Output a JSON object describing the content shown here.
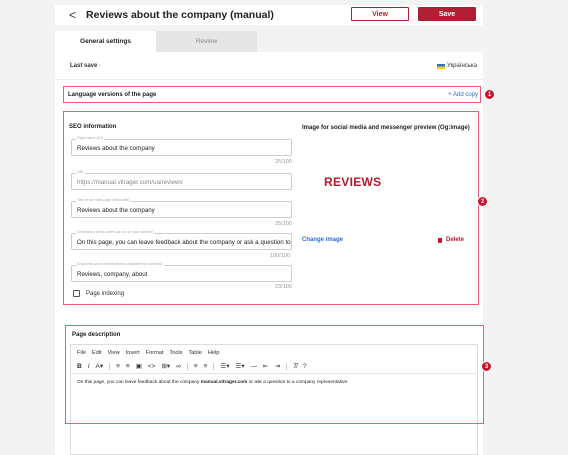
{
  "header": {
    "back_glyph": "<",
    "title": "Reviews about the company (manual)",
    "view_label": "View",
    "save_label": "Save"
  },
  "tabs": [
    {
      "label": "General settings"
    },
    {
      "label": "Review"
    }
  ],
  "panel": {
    "last_save_label": "Last save",
    "last_save_value": "-",
    "language": "Українська",
    "language_versions_label": "Language versions of the page",
    "add_copy_label": "+ Add copy"
  },
  "badges": [
    "1",
    "2",
    "3"
  ],
  "seo": {
    "title": "SEO information",
    "fields": [
      {
        "label": "Page name (H1)",
        "value": "Reviews about the company",
        "counter": "25/100"
      },
      {
        "label": "URL",
        "value": "https://manual.vitrager.com/ua/reviews",
        "counter": ""
      },
      {
        "label": "Title of the main page (Meta-title)",
        "value": "Reviews about the company",
        "counter": "25/100"
      },
      {
        "label": "Description (what users can do on your website)",
        "value": "On this page, you can leave feedback about the company or ask a question to",
        "counter": "100/100"
      },
      {
        "label": "Keywords (word combinations separated by commas)",
        "value": "Reviews, company, about",
        "counter": "23/100"
      }
    ],
    "page_indexing_label": "Page indexing",
    "og_title": "Image for social media and messenger preview (Og:image)",
    "og_image_text": "REVIEWS",
    "change_image_label": "Change image",
    "delete_label": "Delete"
  },
  "description": {
    "title": "Page description",
    "menu": [
      "File",
      "Edit",
      "View",
      "Insert",
      "Format",
      "Tools",
      "Table",
      "Help"
    ],
    "content_prefix": "On this page, you can leave feedback about the company ",
    "content_bold": "manual.vitrager.com",
    "content_suffix": " or ask a question to a company representative."
  },
  "colors": {
    "accent": "#b11f34",
    "link": "#2a6fd8",
    "highlight_border": "#e75c79"
  }
}
